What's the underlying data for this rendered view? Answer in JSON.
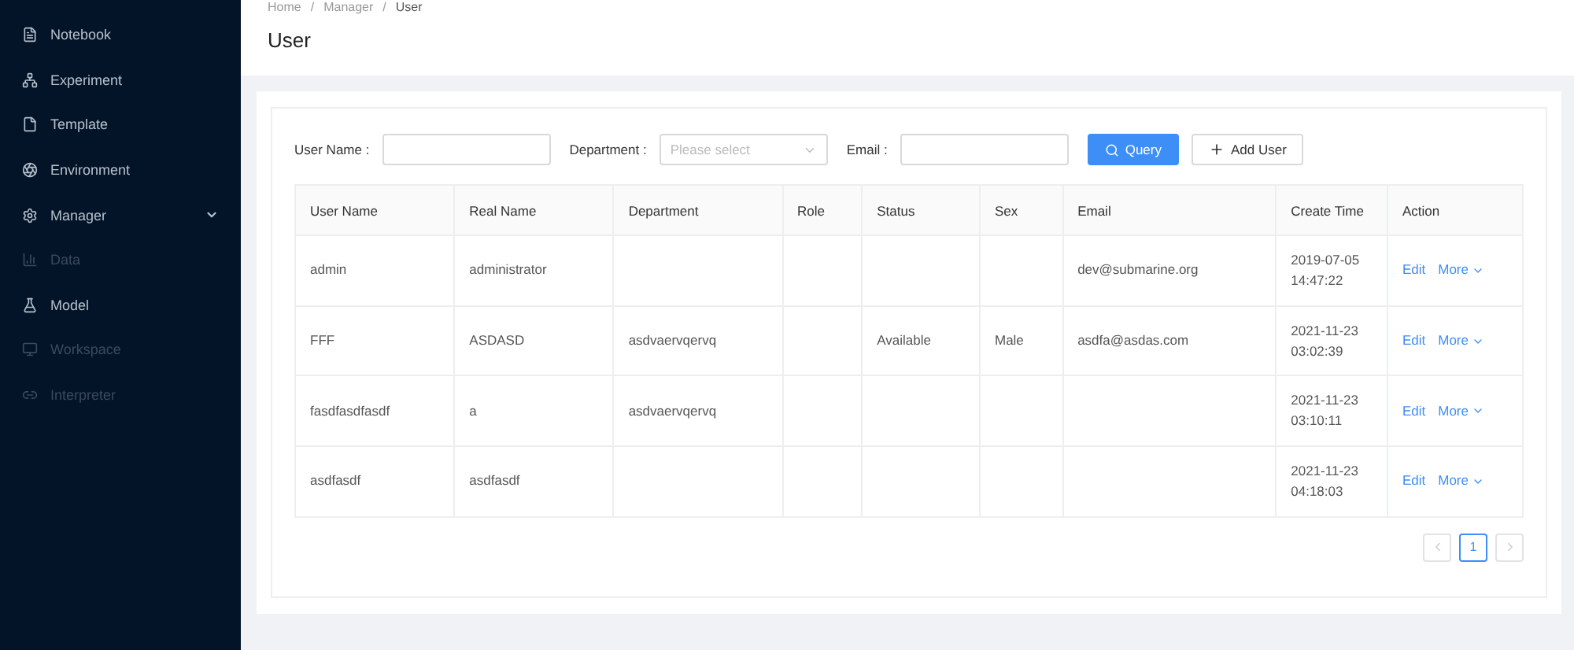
{
  "sidebar": {
    "items": [
      {
        "label": "Notebook",
        "disabled": false,
        "expanded": false
      },
      {
        "label": "Experiment",
        "disabled": false,
        "expanded": false
      },
      {
        "label": "Template",
        "disabled": false,
        "expanded": false
      },
      {
        "label": "Environment",
        "disabled": false,
        "expanded": false
      },
      {
        "label": "Manager",
        "disabled": false,
        "expanded": true
      },
      {
        "label": "Data",
        "disabled": true,
        "expanded": false
      },
      {
        "label": "Model",
        "disabled": false,
        "expanded": false
      },
      {
        "label": "Workspace",
        "disabled": true,
        "expanded": false
      },
      {
        "label": "Interpreter",
        "disabled": true,
        "expanded": false
      }
    ]
  },
  "breadcrumb": {
    "items": [
      "Home",
      "Manager",
      "User"
    ],
    "separator": "/"
  },
  "page_title": "User",
  "filters": [
    {
      "kind": "input",
      "label": "User Name :"
    },
    {
      "kind": "select",
      "label": "Department :",
      "placeholder": "Please select"
    },
    {
      "kind": "input",
      "label": "Email :"
    }
  ],
  "buttons": [
    {
      "kind": "primary",
      "label": "Query"
    },
    {
      "kind": "default",
      "label": "Add User"
    }
  ],
  "table": {
    "columns": [
      "User Name",
      "Real Name",
      "Department",
      "Role",
      "Status",
      "Sex",
      "Email",
      "Create Time",
      "Action"
    ],
    "rows": [
      {
        "cells": [
          "admin",
          "administrator",
          "",
          "",
          "",
          "",
          "dev@submarine.org",
          [
            "2019-07-05",
            "14:47:22"
          ]
        ],
        "actions": [
          "Edit",
          "More"
        ]
      },
      {
        "cells": [
          "FFF",
          "ASDASD",
          "asdvaervqervq",
          "",
          "Available",
          "Male",
          "asdfa@asdas.com",
          [
            "2021-11-23",
            "03:02:39"
          ]
        ],
        "actions": [
          "Edit",
          "More"
        ]
      },
      {
        "cells": [
          "fasdfasdfasdf",
          "a",
          "asdvaervqervq",
          "",
          "",
          "",
          "",
          [
            "2021-11-23",
            "03:10:11"
          ]
        ],
        "actions": [
          "Edit",
          "More"
        ]
      },
      {
        "cells": [
          "asdfasdf",
          "asdfasdf",
          "",
          "",
          "",
          "",
          "",
          [
            "2021-11-23",
            "04:18:03"
          ]
        ],
        "actions": [
          "Edit",
          "More"
        ]
      }
    ]
  },
  "pagination": {
    "pages": [
      {
        "label": "1",
        "selected": true
      }
    ]
  }
}
